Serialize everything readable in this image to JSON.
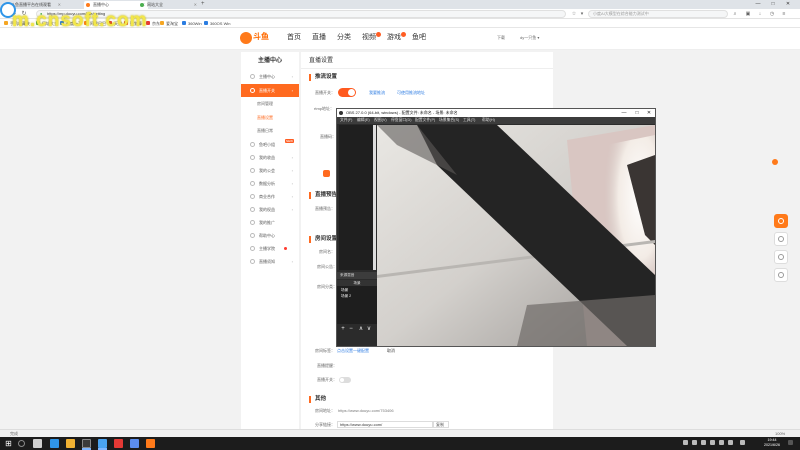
{
  "browser": {
    "tabs": [
      {
        "label": "斗鱼直播平台在线观看",
        "active": false
      },
      {
        "label": "直播中心",
        "active": true
      },
      {
        "label": "网站大全",
        "active": false
      }
    ],
    "new_tab": "+",
    "url": "https://mp.douyu.com/live/setting",
    "search_placeholder": "小度AI大模型在综合能力测试中",
    "window_controls": [
      "—",
      "□",
      "✕"
    ],
    "bookmarks": [
      "手机收藏夹",
      "网址大全",
      "百度一下",
      "阿里巴巴",
      "天猫",
      "聚划算",
      "京东",
      "爱淘宝",
      "360Win",
      "360OS Win"
    ]
  },
  "watermark": {
    "text": "m.cnsoft.com"
  },
  "site": {
    "logo_text": "斗鱼",
    "nav": [
      "首页",
      "直播",
      "分类",
      "视频",
      "游戏",
      "鱼吧"
    ],
    "nav_badges": [
      false,
      false,
      false,
      true,
      true,
      false
    ],
    "header_links": [
      "下载",
      "dy一只鱼 ▾"
    ]
  },
  "sidebar": {
    "title": "主播中心",
    "items": [
      {
        "label": "主播中心",
        "active": false,
        "arrow": "›"
      },
      {
        "label": "直播开关",
        "active": true,
        "arrow": "›"
      },
      {
        "label": "房间管理",
        "sub": true
      },
      {
        "label": "直播设置",
        "sub": true,
        "active": true
      },
      {
        "label": "直播日常",
        "sub": true
      },
      {
        "label": "鱼吧小组",
        "active": false,
        "tag": "NEW"
      },
      {
        "label": "我的收益",
        "active": false,
        "arrow": "›"
      },
      {
        "label": "我的公会",
        "active": false,
        "arrow": "›"
      },
      {
        "label": "数据分析",
        "active": false,
        "arrow": "›"
      },
      {
        "label": "商业合作",
        "active": false,
        "arrow": "›"
      },
      {
        "label": "我的权益",
        "active": false,
        "arrow": "›"
      },
      {
        "label": "我的推广",
        "active": false
      },
      {
        "label": "帮助中心",
        "active": false
      },
      {
        "label": "主播学院",
        "active": false,
        "reddot": true
      },
      {
        "label": "直播须知",
        "active": false,
        "arrow": "›"
      }
    ]
  },
  "content": {
    "page_title": "直播设置",
    "sections": {
      "stream": {
        "title": "推流设置",
        "open_label": "直播开关：",
        "link1": "我要推流",
        "link2": "可使用推流地址",
        "rtmp_label": "rtmp地址：",
        "code_label": "直播码："
      },
      "notice": {
        "title": "直播预告",
        "label": "直播预告："
      },
      "room": {
        "title": "房间设置",
        "label_a": "房间名：",
        "label_b": "房间公告：",
        "label_c": "房间分类：",
        "label_d": "房间标签：",
        "link_d": "点击设置一键配置",
        "label_e": "直播提醒：",
        "label_f": "直播开关：",
        "cancel_text": "取消"
      },
      "other": {
        "title": "其他",
        "home_label": "房间地址：",
        "home_value": "https://www.douyu.com/753406",
        "share_label": "分享链接：",
        "share_value": "https://www.douyu.com/",
        "share_select": "复制"
      }
    }
  },
  "obs": {
    "title": "OBS 27.0.0 (64-bit, windows) - 配置文件: 未命名 - 场景: 未命名",
    "menu": [
      "文件(F)",
      "编辑(E)",
      "视图(V)",
      "停靠窗口(D)",
      "配置文件(P)",
      "场景集合(S)",
      "工具(T)",
      "帮助(H)"
    ],
    "scenes_header": "来源混音",
    "sources_header": "场景",
    "sources": [
      "场景",
      "场景 2"
    ],
    "buttons": [
      "+",
      "−",
      "∧",
      "∨"
    ]
  },
  "statusbar": {
    "left": "完成",
    "right": "100%"
  },
  "taskbar": {
    "clock_time": "19:44",
    "clock_date": "2021/6/26"
  }
}
